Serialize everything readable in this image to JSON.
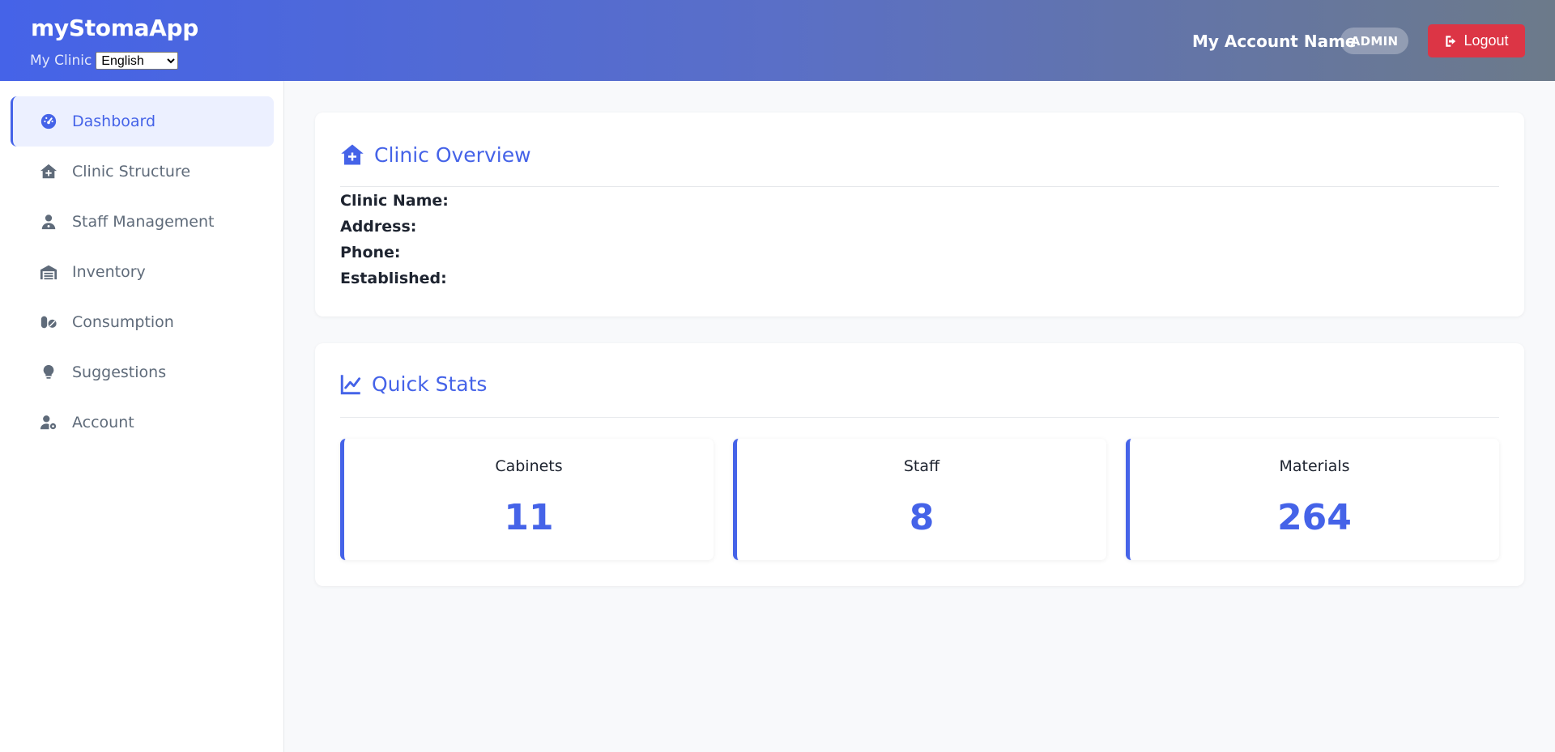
{
  "header": {
    "brand": "myStomaApp",
    "clinic_label": "My Clinic",
    "language_selected": "English",
    "account_name": "My Account Name",
    "role": "ADMIN",
    "logout_label": "Logout"
  },
  "sidebar": {
    "items": [
      {
        "label": "Dashboard",
        "icon": "gauge-icon",
        "active": true
      },
      {
        "label": "Clinic Structure",
        "icon": "clinic-house-icon",
        "active": false
      },
      {
        "label": "Staff Management",
        "icon": "doctor-icon",
        "active": false
      },
      {
        "label": "Inventory",
        "icon": "warehouse-icon",
        "active": false
      },
      {
        "label": "Consumption",
        "icon": "pills-icon",
        "active": false
      },
      {
        "label": "Suggestions",
        "icon": "lightbulb-icon",
        "active": false
      },
      {
        "label": "Account",
        "icon": "user-gear-icon",
        "active": false
      }
    ]
  },
  "overview": {
    "title": "Clinic Overview",
    "clinic_name_label": "Clinic Name:",
    "address_label": "Address:",
    "phone_label": "Phone:",
    "established_label": "Established:"
  },
  "stats": {
    "title": "Quick Stats",
    "items": [
      {
        "label": "Cabinets",
        "value": "11"
      },
      {
        "label": "Staff",
        "value": "8"
      },
      {
        "label": "Materials",
        "value": "264"
      }
    ]
  },
  "colors": {
    "accent": "#4563e8",
    "danger": "#dc3545",
    "active_bg": "#ecf0ff"
  }
}
